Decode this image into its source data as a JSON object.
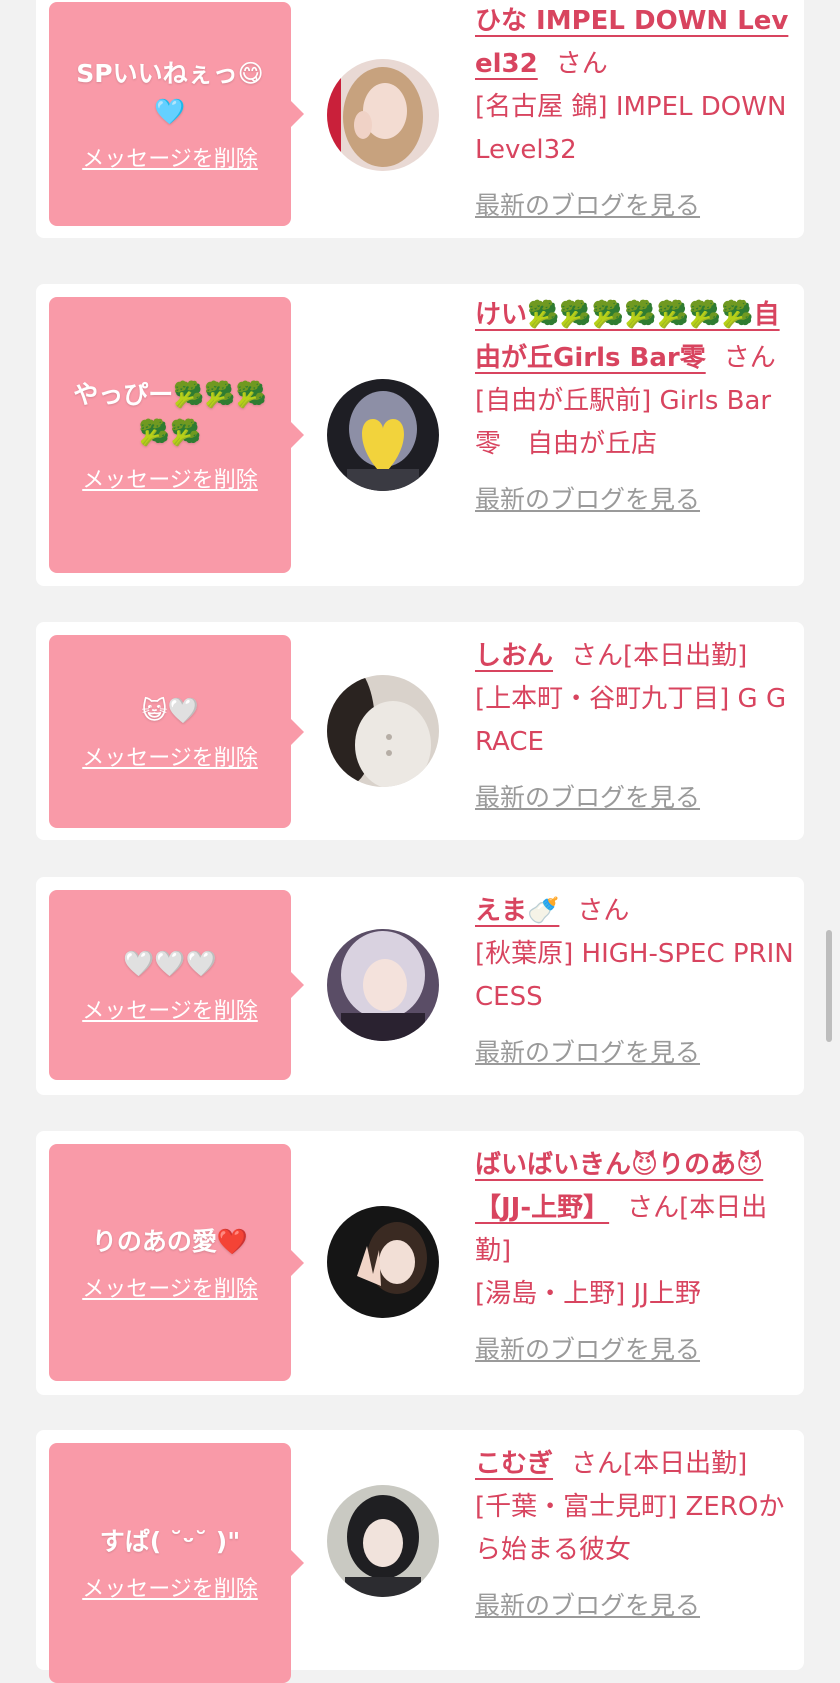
{
  "common": {
    "delete_label": "メッセージを削除",
    "blog_label": "最新のブログを見る",
    "honorific": "さん"
  },
  "items": [
    {
      "message": "SPいいねぇっ😋🩵",
      "name": "ひな IMPEL DOWN Level32",
      "status": "",
      "shop": "[名古屋 錦] IMPEL DOWN Level32"
    },
    {
      "message": "やっぴー🥦🥦🥦🥦🥦",
      "name": "けい🥦🥦🥦🥦🥦🥦🥦自由が丘Girls Bar零",
      "status": "",
      "shop": "[自由が丘駅前] Girls Bar零　自由が丘店"
    },
    {
      "message": "😺🤍",
      "name": "しおん",
      "status": "[本日出勤]",
      "shop": "[上本町・谷町九丁目] G GRACE"
    },
    {
      "message": "🤍🤍🤍",
      "name": "えま🍼",
      "status": "",
      "shop": "[秋葉原] HIGH-SPEC PRINCESS"
    },
    {
      "message": "りのあの愛❤️",
      "name": "ばいばいきん😈りのあ😈【JJ-上野】",
      "status": "[本日出勤]",
      "shop": "[湯島・上野] JJ上野"
    },
    {
      "message": "すぱ( ˘ᵕ˘ )\"",
      "name": "こむぎ",
      "status": "[本日出勤]",
      "shop": "[千葉・富士見町] ZEROから始まる彼女"
    }
  ]
}
